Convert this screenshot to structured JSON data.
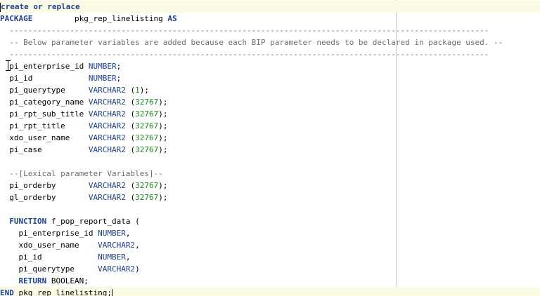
{
  "editor": {
    "lines": [
      {
        "segments": [
          {
            "t": "create or replace",
            "c": "kw"
          }
        ],
        "highlight": true,
        "caret": "start"
      },
      {
        "segments": [
          {
            "t": "PACKAGE",
            "c": "kw"
          },
          {
            "t": "         pkg_rep_linelisting ",
            "c": ""
          },
          {
            "t": "AS",
            "c": "kw"
          }
        ]
      },
      {
        "segments": [
          {
            "t": "  -------------------------------------------------------------------------------------------------------",
            "c": "cm"
          }
        ]
      },
      {
        "segments": [
          {
            "t": "  -- Below parameter variables are added because each BIP parameter needs to be declared in package used. --",
            "c": "cm"
          }
        ]
      },
      {
        "segments": [
          {
            "t": "  -------------------------------------------------------------------------------------------------------",
            "c": "cm"
          }
        ]
      },
      {
        "segments": [
          {
            "t": "  pi_enterprise_id ",
            "c": ""
          },
          {
            "t": "NUMBER",
            "c": "ty"
          },
          {
            "t": ";",
            "c": ""
          }
        ]
      },
      {
        "segments": [
          {
            "t": "  pi_id            ",
            "c": ""
          },
          {
            "t": "NUMBER",
            "c": "ty"
          },
          {
            "t": ";",
            "c": ""
          }
        ]
      },
      {
        "segments": [
          {
            "t": "  pi_querytype     ",
            "c": ""
          },
          {
            "t": "VARCHAR2",
            "c": "ty"
          },
          {
            "t": " (",
            "c": ""
          },
          {
            "t": "1",
            "c": "num"
          },
          {
            "t": ");",
            "c": ""
          }
        ]
      },
      {
        "segments": [
          {
            "t": "  pi_category_name ",
            "c": ""
          },
          {
            "t": "VARCHAR2",
            "c": "ty"
          },
          {
            "t": " (",
            "c": ""
          },
          {
            "t": "32767",
            "c": "num"
          },
          {
            "t": ");",
            "c": ""
          }
        ]
      },
      {
        "segments": [
          {
            "t": "  pi_rpt_sub_title ",
            "c": ""
          },
          {
            "t": "VARCHAR2",
            "c": "ty"
          },
          {
            "t": " (",
            "c": ""
          },
          {
            "t": "32767",
            "c": "num"
          },
          {
            "t": ");",
            "c": ""
          }
        ]
      },
      {
        "segments": [
          {
            "t": "  pi_rpt_title     ",
            "c": ""
          },
          {
            "t": "VARCHAR2",
            "c": "ty"
          },
          {
            "t": " (",
            "c": ""
          },
          {
            "t": "32767",
            "c": "num"
          },
          {
            "t": ");",
            "c": ""
          }
        ]
      },
      {
        "segments": [
          {
            "t": "  xdo_user_name    ",
            "c": ""
          },
          {
            "t": "VARCHAR2",
            "c": "ty"
          },
          {
            "t": " (",
            "c": ""
          },
          {
            "t": "32767",
            "c": "num"
          },
          {
            "t": ");",
            "c": ""
          }
        ]
      },
      {
        "segments": [
          {
            "t": "  pi_case          ",
            "c": ""
          },
          {
            "t": "VARCHAR2",
            "c": "ty"
          },
          {
            "t": " (",
            "c": ""
          },
          {
            "t": "32767",
            "c": "num"
          },
          {
            "t": ");",
            "c": ""
          }
        ]
      },
      {
        "segments": [
          {
            "t": "",
            "c": ""
          }
        ]
      },
      {
        "segments": [
          {
            "t": "  --[Lexical parameter Variables]--",
            "c": "cm"
          }
        ]
      },
      {
        "segments": [
          {
            "t": "  pi_orderby       ",
            "c": ""
          },
          {
            "t": "VARCHAR2",
            "c": "ty"
          },
          {
            "t": " (",
            "c": ""
          },
          {
            "t": "32767",
            "c": "num"
          },
          {
            "t": ");",
            "c": ""
          }
        ]
      },
      {
        "segments": [
          {
            "t": "  gl_orderby       ",
            "c": ""
          },
          {
            "t": "VARCHAR2",
            "c": "ty"
          },
          {
            "t": " (",
            "c": ""
          },
          {
            "t": "32767",
            "c": "num"
          },
          {
            "t": ");",
            "c": ""
          }
        ]
      },
      {
        "segments": [
          {
            "t": "",
            "c": ""
          }
        ]
      },
      {
        "segments": [
          {
            "t": "  ",
            "c": ""
          },
          {
            "t": "FUNCTION",
            "c": "kw"
          },
          {
            "t": " f_pop_report_data (",
            "c": ""
          }
        ]
      },
      {
        "segments": [
          {
            "t": "    pi_enterprise_id ",
            "c": ""
          },
          {
            "t": "NUMBER",
            "c": "ty"
          },
          {
            "t": ",",
            "c": ""
          }
        ]
      },
      {
        "segments": [
          {
            "t": "    xdo_user_name    ",
            "c": ""
          },
          {
            "t": "VARCHAR2",
            "c": "ty"
          },
          {
            "t": ",",
            "c": ""
          }
        ]
      },
      {
        "segments": [
          {
            "t": "    pi_id            ",
            "c": ""
          },
          {
            "t": "NUMBER",
            "c": "ty"
          },
          {
            "t": ",",
            "c": ""
          }
        ]
      },
      {
        "segments": [
          {
            "t": "    pi_querytype     ",
            "c": ""
          },
          {
            "t": "VARCHAR2",
            "c": "ty"
          },
          {
            "t": ")",
            "c": ""
          }
        ]
      },
      {
        "segments": [
          {
            "t": "    ",
            "c": ""
          },
          {
            "t": "RETURN",
            "c": "kw"
          },
          {
            "t": " BOOLEAN;",
            "c": ""
          }
        ]
      },
      {
        "segments": [
          {
            "t": "END",
            "c": "kw"
          },
          {
            "t": " pkg_rep_linelisting;",
            "c": ""
          }
        ],
        "highlight": true,
        "caret": "end"
      }
    ]
  }
}
